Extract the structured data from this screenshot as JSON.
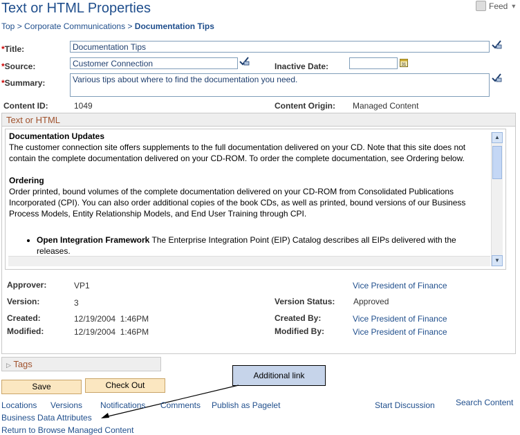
{
  "header": {
    "title": "Text or HTML Properties",
    "feed_label": "Feed"
  },
  "breadcrumb": {
    "top": "Top",
    "sep1": " > ",
    "corp": "Corporate Communications",
    "sep2": " > ",
    "current": "Documentation Tips"
  },
  "form": {
    "title_label": "Title:",
    "title_value": "Documentation Tips",
    "source_label": "Source:",
    "source_value": "Customer Connection",
    "inactive_date_label": "Inactive Date:",
    "inactive_date_value": "",
    "summary_label": "Summary:",
    "summary_value": "Various tips about where to find the documentation you need.",
    "content_id_label": "Content ID:",
    "content_id_value": "1049",
    "content_origin_label": "Content Origin:",
    "content_origin_value": "Managed Content",
    "required_mark": "*"
  },
  "editor": {
    "section_label": "Text or HTML",
    "heading1": "Documentation Updates",
    "para1": "The customer connection site offers supplements to the full documentation delivered on your CD. Note that this site does not contain the complete documentation delivered on your CD-ROM. To order the complete documentation, see Ordering  below.",
    "heading2": "Ordering",
    "para2": "Order printed, bound volumes of the complete documentation delivered on your CD-ROM from Consolidated Publications Incorporated (CPI). You can also order additional copies of the book CDs, as well as printed, bound versions of our Business Process Models, Entity Relationship Models, and End User Training through CPI.",
    "bullet1_bold": "Open Integration Framework",
    "bullet1_text": "  The Enterprise Integration Point (EIP) Catalog describes all EIPs delivered with the releases."
  },
  "meta": {
    "approver_label": "Approver:",
    "approver_value": "VP1",
    "approver_link": "Vice President of Finance",
    "version_label": "Version:",
    "version_value": "3",
    "version_status_label": "Version Status:",
    "version_status_value": "Approved",
    "created_label": "Created:",
    "created_value": "12/19/2004  1:46PM",
    "created_by_label": "Created By:",
    "created_by_value": "Vice President of Finance",
    "modified_label": "Modified:",
    "modified_value": "12/19/2004  1:46PM",
    "modified_by_label": "Modified By:",
    "modified_by_value": "Vice President of Finance"
  },
  "tags": {
    "label": "Tags"
  },
  "buttons": {
    "save": "Save",
    "check_out": "Check Out"
  },
  "callout": {
    "label": "Additional link"
  },
  "links": {
    "locations": "Locations",
    "versions": "Versions",
    "notifications": "Notifications",
    "comments": "Comments",
    "publish_pagelet": "Publish as Pagelet",
    "start_discussion": "Start Discussion",
    "search_content": "Search Content",
    "business_data": "Business Data Attributes",
    "return_browse": "Return to Browse Managed Content"
  },
  "colors": {
    "link": "#1f4e8c",
    "section_header_text": "#a0522d",
    "button_bg": "#fbe7c1",
    "callout_bg": "#c6d4ea"
  }
}
